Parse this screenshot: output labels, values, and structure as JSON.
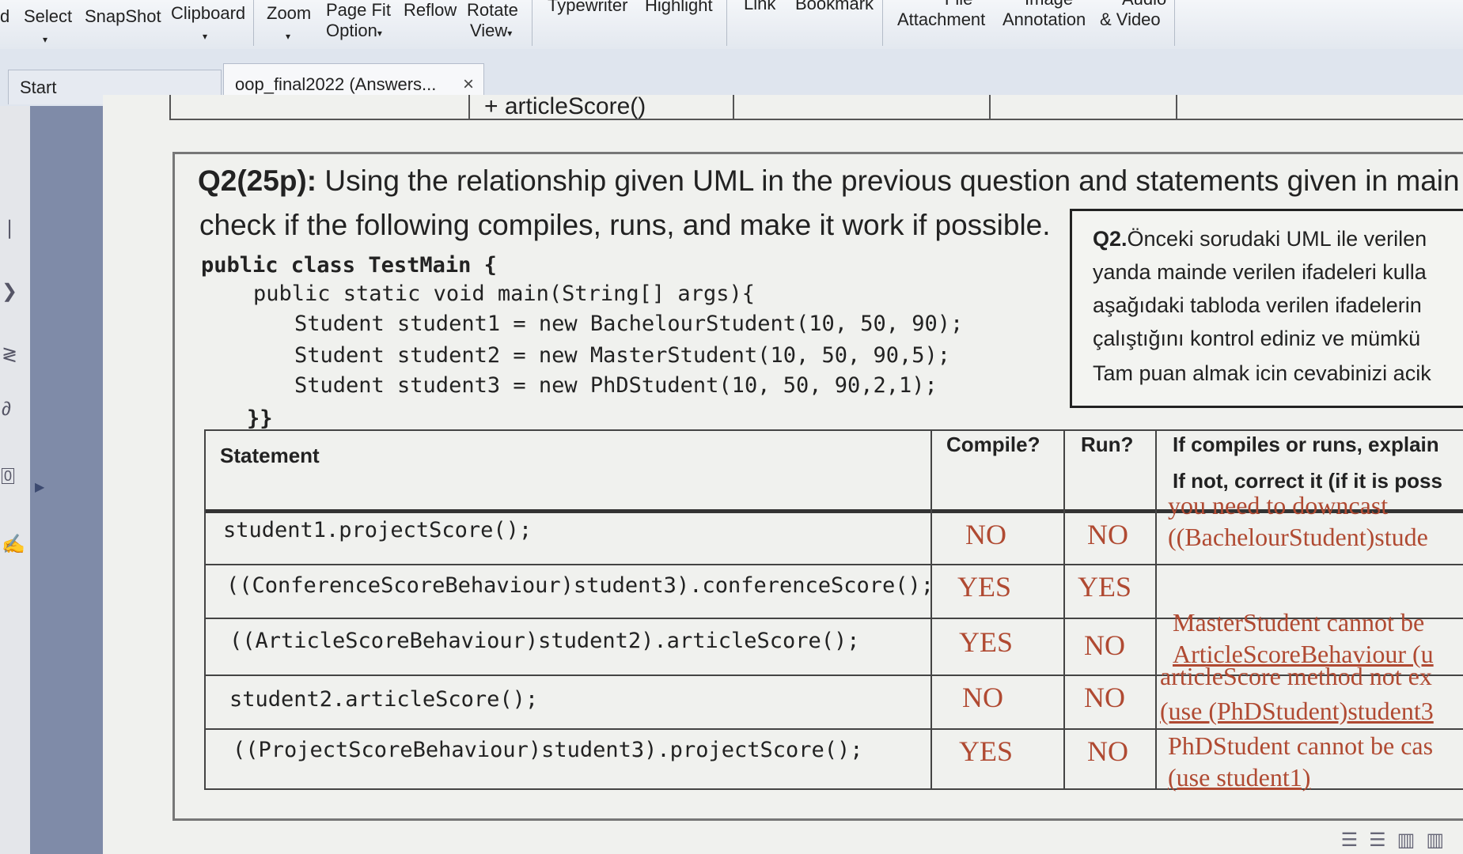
{
  "toolbar": {
    "items": [
      {
        "label": "d"
      },
      {
        "label": "Select"
      },
      {
        "label": "SnapShot"
      },
      {
        "label": "Clipboard"
      },
      {
        "label": "Zoom"
      },
      {
        "label": "Page Fit",
        "sub": "Option"
      },
      {
        "label": "Reflow"
      },
      {
        "label": "Rotate",
        "sub": "View"
      },
      {
        "label": "Typewriter"
      },
      {
        "label": "Highlight"
      },
      {
        "label": "Link"
      },
      {
        "label": "Bookmark"
      },
      {
        "label": "File",
        "sub": "Attachment"
      },
      {
        "label": "Image",
        "sub": "Annotation"
      },
      {
        "label": "Audio",
        "sub": "& Video"
      }
    ]
  },
  "tabs": {
    "start": "Start",
    "document": "oop_final2022 (Answers...",
    "close": "×"
  },
  "document": {
    "prev_row_text": "+ articleScore()",
    "question_label": "Q2(25p):",
    "question_line1": " Using the relationship given UML in the previous question and statements given in main",
    "question_line2": "check if the following compiles, runs, and make it work if possible.",
    "code": [
      "public class TestMain {",
      "public static void main(String[] args){",
      "Student student1 = new BachelourStudent(10, 50, 90);",
      "Student student2 = new MasterStudent(10, 50, 90,5);",
      "Student student3 = new PhDStudent(10, 50, 90,2,1);",
      "}}"
    ],
    "turkish": {
      "label": "Q2.",
      "line1": "Önceki sorudaki UML ile verilen",
      "line2": "yanda mainde verilen ifadeleri kulla",
      "line3": "aşağıdaki tabloda verilen ifadelerin",
      "line4": "çalıştığını kontrol ediniz ve mümkü",
      "line5": "Tam puan almak icin cevabinizi acik"
    },
    "table": {
      "headers": {
        "statement": "Statement",
        "compile": "Compile?",
        "run": "Run?",
        "explain1": "If compiles or runs, explain",
        "explain2": "If not, correct it (if it is poss"
      },
      "rows": [
        {
          "statement": "student1.projectScore();",
          "compile": "NO",
          "run": "NO",
          "explain1": "you need to downcast",
          "explain2": "((BachelourStudent)stude"
        },
        {
          "statement": "((ConferenceScoreBehaviour)student3).conferenceScore();",
          "compile": "YES",
          "run": "YES",
          "explain1": "",
          "explain2": ""
        },
        {
          "statement": "((ArticleScoreBehaviour)student2).articleScore();",
          "compile": "YES",
          "run": "NO",
          "explain1": "MasterStudent cannot be",
          "explain2": "ArticleScoreBehaviour (u"
        },
        {
          "statement": "student2.articleScore();",
          "compile": "NO",
          "run": "NO",
          "explain1": "articleScore method not ex",
          "explain2": "(use (PhDStudent)student3"
        },
        {
          "statement": "((ProjectScoreBehaviour)student3).projectScore();",
          "compile": "YES",
          "run": "NO",
          "explain1": "PhDStudent cannot be cas",
          "explain2": "(use student1)"
        }
      ]
    }
  }
}
